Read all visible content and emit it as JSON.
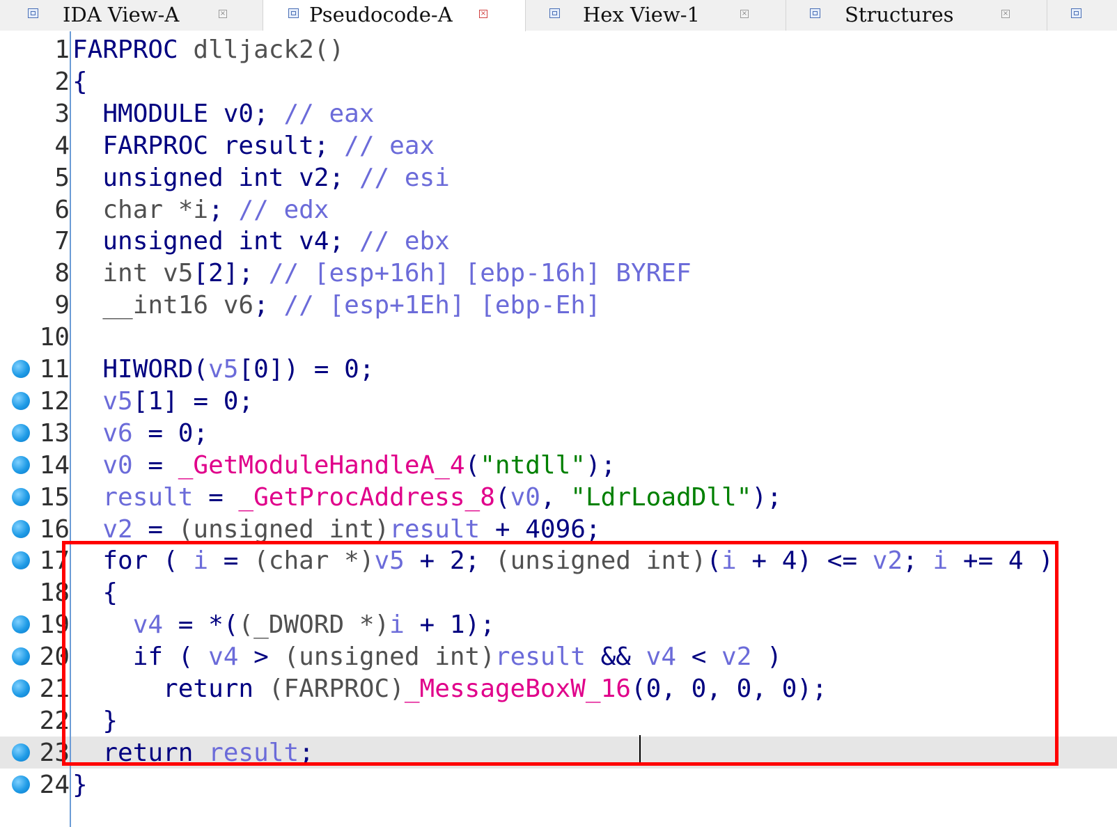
{
  "tabs": [
    {
      "label": "IDA View-A",
      "icon": "disasm-view-icon",
      "active": false
    },
    {
      "label": "Pseudocode-A",
      "icon": "pseudocode-icon",
      "active": true
    },
    {
      "label": "Hex View-1",
      "icon": "hex-view-icon",
      "active": false
    },
    {
      "label": "Structures",
      "icon": "structures-icon",
      "active": false
    },
    {
      "label": "",
      "icon": "enums-icon",
      "active": false
    }
  ],
  "colors": {
    "keyword": "#000080",
    "variable": "#6b6bd9",
    "function": "#e0008a",
    "string": "#008000",
    "breakpoint": "#1f9be6",
    "highlight_box": "#ff0000"
  },
  "code_lines": [
    {
      "n": "1",
      "bp": false,
      "tokens": [
        [
          "t-type",
          "FARPROC "
        ],
        [
          "t-gray",
          "dlljack2()"
        ]
      ]
    },
    {
      "n": "2",
      "bp": false,
      "tokens": [
        [
          "t-p",
          "{"
        ]
      ]
    },
    {
      "n": "3",
      "bp": false,
      "tokens": [
        [
          "t-p",
          "  HMODULE v0; "
        ],
        [
          "t-cmt",
          "// eax"
        ]
      ]
    },
    {
      "n": "4",
      "bp": false,
      "tokens": [
        [
          "t-p",
          "  FARPROC result; "
        ],
        [
          "t-cmt",
          "// eax"
        ]
      ]
    },
    {
      "n": "5",
      "bp": false,
      "tokens": [
        [
          "t-p",
          "  unsigned int v2; "
        ],
        [
          "t-cmt",
          "// esi"
        ]
      ]
    },
    {
      "n": "6",
      "bp": false,
      "tokens": [
        [
          "t-gray",
          "  char *i"
        ],
        [
          "t-p",
          "; "
        ],
        [
          "t-cmt",
          "// edx"
        ]
      ]
    },
    {
      "n": "7",
      "bp": false,
      "tokens": [
        [
          "t-p",
          "  unsigned int v4; "
        ],
        [
          "t-cmt",
          "// ebx"
        ]
      ]
    },
    {
      "n": "8",
      "bp": false,
      "tokens": [
        [
          "t-gray",
          "  int v5"
        ],
        [
          "t-p",
          "[2]; "
        ],
        [
          "t-cmt",
          "// [esp+16h] [ebp-16h] BYREF"
        ]
      ]
    },
    {
      "n": "9",
      "bp": false,
      "tokens": [
        [
          "t-gray",
          "  __int16 v6"
        ],
        [
          "t-p",
          "; "
        ],
        [
          "t-cmt",
          "// [esp+1Eh] [ebp-Eh]"
        ]
      ]
    },
    {
      "n": "10",
      "bp": false,
      "tokens": []
    },
    {
      "n": "11",
      "bp": true,
      "tokens": [
        [
          "t-p",
          "  HIWORD("
        ],
        [
          "t-var",
          "v5"
        ],
        [
          "t-p",
          "[0]) = 0;"
        ]
      ]
    },
    {
      "n": "12",
      "bp": true,
      "tokens": [
        [
          "t-var",
          "  v5"
        ],
        [
          "t-p",
          "[1] = 0;"
        ]
      ]
    },
    {
      "n": "13",
      "bp": true,
      "tokens": [
        [
          "t-var",
          "  v6"
        ],
        [
          "t-p",
          " = 0;"
        ]
      ]
    },
    {
      "n": "14",
      "bp": true,
      "tokens": [
        [
          "t-var",
          "  v0"
        ],
        [
          "t-p",
          " = "
        ],
        [
          "t-fn",
          "_GetModuleHandleA_4"
        ],
        [
          "t-p",
          "("
        ],
        [
          "t-str",
          "\"ntdll\""
        ],
        [
          "t-p",
          ");"
        ]
      ]
    },
    {
      "n": "15",
      "bp": true,
      "tokens": [
        [
          "t-var",
          "  result"
        ],
        [
          "t-p",
          " = "
        ],
        [
          "t-fn",
          "_GetProcAddress_8"
        ],
        [
          "t-p",
          "("
        ],
        [
          "t-var",
          "v0"
        ],
        [
          "t-p",
          ", "
        ],
        [
          "t-str",
          "\"LdrLoadDll\""
        ],
        [
          "t-p",
          ");"
        ]
      ]
    },
    {
      "n": "16",
      "bp": true,
      "tokens": [
        [
          "t-var",
          "  v2"
        ],
        [
          "t-p",
          " = "
        ],
        [
          "t-cast",
          "(unsigned int)"
        ],
        [
          "t-var",
          "result"
        ],
        [
          "t-p",
          " + 4096;"
        ]
      ]
    },
    {
      "n": "17",
      "bp": true,
      "tokens": [
        [
          "t-p",
          "  for ( "
        ],
        [
          "t-var",
          "i"
        ],
        [
          "t-p",
          " = "
        ],
        [
          "t-cast",
          "(char *)"
        ],
        [
          "t-var",
          "v5"
        ],
        [
          "t-p",
          " + 2; "
        ],
        [
          "t-cast",
          "(unsigned int)"
        ],
        [
          "t-p",
          "("
        ],
        [
          "t-var",
          "i"
        ],
        [
          "t-p",
          " + 4) <= "
        ],
        [
          "t-var",
          "v2"
        ],
        [
          "t-p",
          "; "
        ],
        [
          "t-var",
          "i"
        ],
        [
          "t-p",
          " += 4 )"
        ]
      ]
    },
    {
      "n": "18",
      "bp": false,
      "tokens": [
        [
          "t-p",
          "  {"
        ]
      ]
    },
    {
      "n": "19",
      "bp": true,
      "tokens": [
        [
          "t-var",
          "    v4"
        ],
        [
          "t-p",
          " = *("
        ],
        [
          "t-cast",
          "(_DWORD *)"
        ],
        [
          "t-var",
          "i"
        ],
        [
          "t-p",
          " + 1);"
        ]
      ]
    },
    {
      "n": "20",
      "bp": true,
      "tokens": [
        [
          "t-p",
          "    if ( "
        ],
        [
          "t-var",
          "v4"
        ],
        [
          "t-p",
          " > "
        ],
        [
          "t-cast",
          "(unsigned int)"
        ],
        [
          "t-var",
          "result"
        ],
        [
          "t-p",
          " && "
        ],
        [
          "t-var",
          "v4"
        ],
        [
          "t-p",
          " < "
        ],
        [
          "t-var",
          "v2"
        ],
        [
          "t-p",
          " )"
        ]
      ]
    },
    {
      "n": "21",
      "bp": true,
      "tokens": [
        [
          "t-p",
          "      return "
        ],
        [
          "t-cast",
          "(FARPROC)"
        ],
        [
          "t-fn",
          "_MessageBoxW_16"
        ],
        [
          "t-p",
          "(0, 0, 0, 0);"
        ]
      ]
    },
    {
      "n": "22",
      "bp": false,
      "tokens": [
        [
          "t-p",
          "  }"
        ]
      ]
    },
    {
      "n": "23",
      "bp": true,
      "current": true,
      "tokens": [
        [
          "t-p",
          "  return "
        ],
        [
          "t-var",
          "result"
        ],
        [
          "t-p",
          ";"
        ]
      ]
    },
    {
      "n": "24",
      "bp": true,
      "tokens": [
        [
          "t-p",
          "}"
        ]
      ]
    }
  ]
}
